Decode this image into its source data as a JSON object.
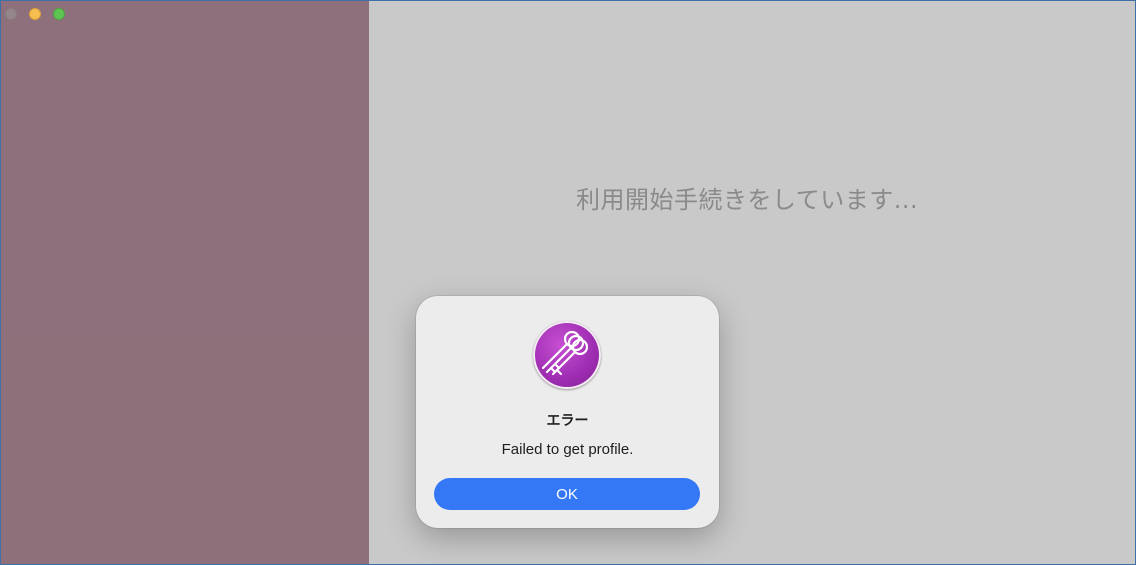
{
  "window": {
    "controls": [
      "close",
      "minimize",
      "maximize"
    ]
  },
  "main": {
    "status_text": "利用開始手続きをしています..."
  },
  "dialog": {
    "icon": "keys-icon",
    "title": "エラー",
    "message": "Failed to get profile.",
    "ok_label": "OK"
  },
  "colors": {
    "sidebar": "#8d707c",
    "main_background": "#c8c9c8",
    "accent_button": "#3478f6",
    "icon_purple": "#9c2bb0"
  }
}
